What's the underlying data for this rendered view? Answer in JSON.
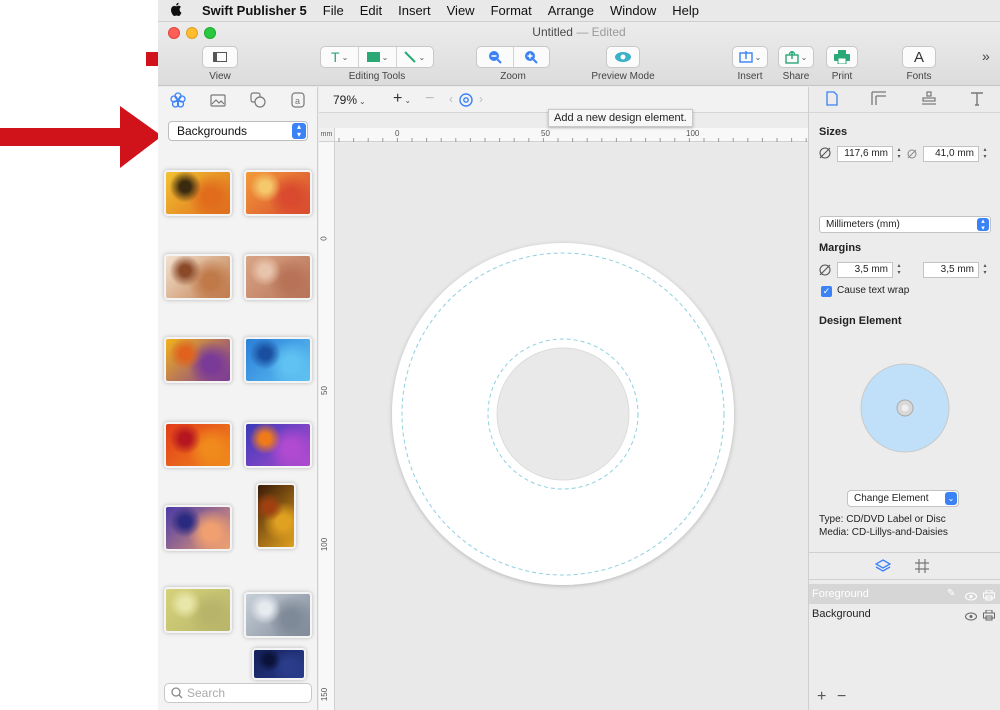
{
  "menubar": {
    "app_name": "Swift Publisher 5",
    "items": [
      "File",
      "Edit",
      "Insert",
      "View",
      "Format",
      "Arrange",
      "Window",
      "Help"
    ]
  },
  "window": {
    "title": "Untitled",
    "title_status": "— Edited"
  },
  "toolbar": {
    "view_label": "View",
    "editing_tools_label": "Editing Tools",
    "zoom_label": "Zoom",
    "preview_label": "Preview Mode",
    "insert_label": "Insert",
    "share_label": "Share",
    "print_label": "Print",
    "fonts_label": "Fonts",
    "fonts_glyph": "A",
    "overflow_glyph": "»",
    "text_tool_glyph": "T"
  },
  "left_panel": {
    "category": "Backgrounds",
    "search_placeholder": "Search",
    "thumbnails": [
      {
        "name": "bg-yellow-grunge",
        "colors": [
          "#f1c232",
          "#e06c1c",
          "#3a2a10"
        ]
      },
      {
        "name": "bg-orange-streaks",
        "colors": [
          "#f29a3a",
          "#d94a2e",
          "#f5c86b"
        ]
      },
      {
        "name": "bg-brown-dots",
        "colors": [
          "#f3e3d0",
          "#c07a4a",
          "#8a4a2a"
        ]
      },
      {
        "name": "bg-copper-texture",
        "colors": [
          "#d9a486",
          "#b87357",
          "#e8c4ac"
        ]
      },
      {
        "name": "bg-purple-gold",
        "colors": [
          "#f2b21b",
          "#7a3a98",
          "#e0621d"
        ]
      },
      {
        "name": "bg-blue-watercolor",
        "colors": [
          "#2b7fd9",
          "#5fc2f2",
          "#1a4fa0"
        ]
      },
      {
        "name": "bg-red-orange",
        "colors": [
          "#e23b1a",
          "#f08a1c",
          "#b5161f"
        ]
      },
      {
        "name": "bg-blue-purple-orange",
        "colors": [
          "#3a3ab8",
          "#b04ad0",
          "#f07a1a"
        ]
      },
      {
        "name": "bg-purple-flowers",
        "colors": [
          "#4a3aa8",
          "#f0a070",
          "#2a2a80"
        ]
      },
      {
        "name": "bg-dark-forest",
        "colors": [
          "#3a1a08",
          "#e0a020",
          "#a04010"
        ]
      },
      {
        "name": "bg-olive-paper",
        "colors": [
          "#d5d27a",
          "#b8b56a",
          "#e8e6a8"
        ]
      },
      {
        "name": "bg-grey-swirl",
        "colors": [
          "#c7cfd8",
          "#7f8a98",
          "#e6ebf0"
        ]
      },
      {
        "name": "bg-navy-night",
        "colors": [
          "#13205a",
          "#2a3c8a",
          "#0a1238"
        ]
      }
    ]
  },
  "canvas": {
    "zoom": "79%",
    "tooltip": "Add a new design element.",
    "ruler_unit": "mm",
    "h_ticks": [
      "0",
      "50",
      "100"
    ],
    "v_ticks": [
      "0",
      "50",
      "100",
      "150"
    ]
  },
  "inspector": {
    "sizes_heading": "Sizes",
    "width": "117,6 mm",
    "height": "41,0 mm",
    "units": "Millimeters (mm)",
    "margins_heading": "Margins",
    "margin_a": "3,5 mm",
    "margin_b": "3,5 mm",
    "text_wrap_label": "Cause text wrap",
    "text_wrap_checked": true,
    "design_element_heading": "Design Element",
    "change_element_label": "Change Element",
    "type_line": "Type: CD/DVD Label or Disc",
    "media_line": "Media: CD-Lillys-and-Daisies",
    "layers": [
      "Foreground",
      "Background"
    ],
    "add_glyph": "+",
    "remove_glyph": "−"
  },
  "colors": {
    "accent": "#3b82f6",
    "annotation_red": "#d0121b",
    "disc_fill": "#bfe0f8",
    "guide_dash": "#8fd0e0"
  }
}
